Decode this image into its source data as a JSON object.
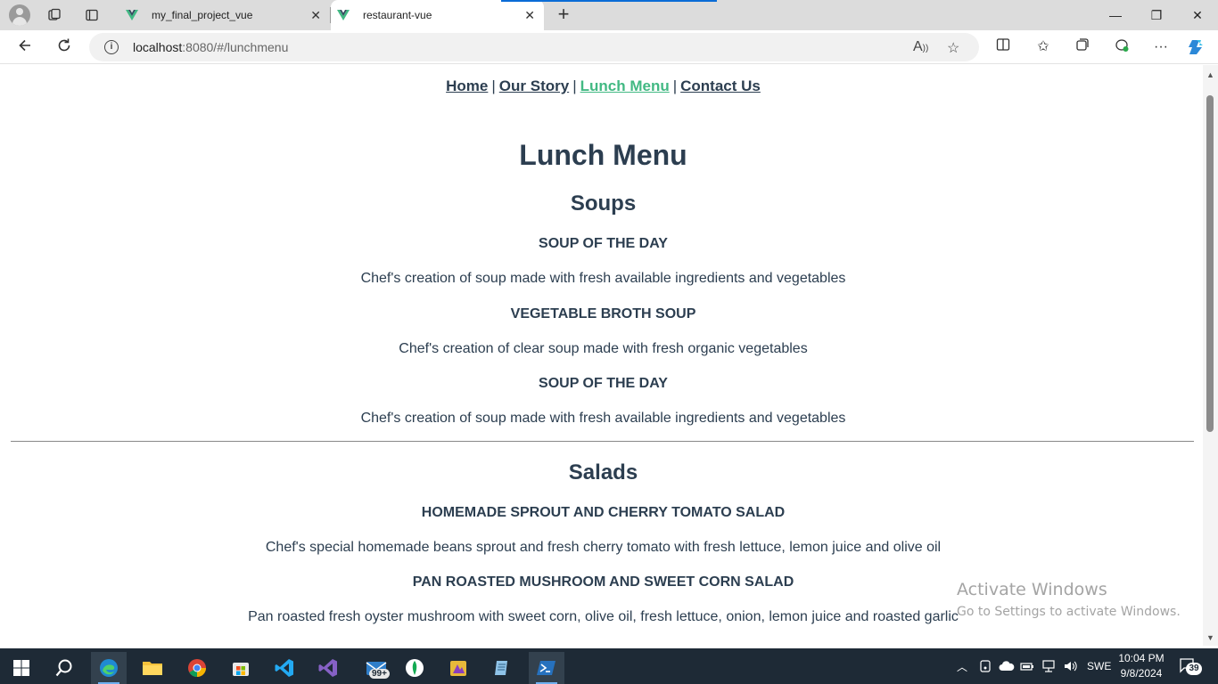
{
  "browser": {
    "tabs": [
      {
        "title": "my_final_project_vue",
        "active": false
      },
      {
        "title": "restaurant-vue",
        "active": true
      }
    ],
    "url_host": "localhost",
    "url_rest": ":8080/#/lunchmenu"
  },
  "nav": {
    "items": [
      "Home",
      "Our Story",
      "Lunch Menu",
      "Contact Us"
    ],
    "separator": "|",
    "active_index": 2
  },
  "page": {
    "title": "Lunch Menu",
    "sections": [
      {
        "title": "Soups",
        "items": [
          {
            "name": "SOUP OF THE DAY",
            "description": "Chef's creation of soup made with fresh available ingredients and vegetables"
          },
          {
            "name": "VEGETABLE BROTH SOUP",
            "description": "Chef's creation of clear soup made with fresh organic vegetables"
          },
          {
            "name": "SOUP OF THE DAY",
            "description": "Chef's creation of soup made with fresh available ingredients and vegetables"
          }
        ]
      },
      {
        "title": "Salads",
        "items": [
          {
            "name": "HOMEMADE SPROUT AND CHERRY TOMATO SALAD",
            "description": "Chef's special homemade beans sprout and fresh cherry tomato with fresh lettuce, lemon juice and olive oil"
          },
          {
            "name": "PAN ROASTED MUSHROOM AND SWEET CORN SALAD",
            "description": "Pan roasted fresh oyster mushroom with sweet corn, olive oil, fresh lettuce, onion, lemon juice and roasted garlic"
          }
        ]
      }
    ]
  },
  "watermark": {
    "line1": "Activate Windows",
    "line2": "Go to Settings to activate Windows."
  },
  "taskbar": {
    "mail_badge": "99+",
    "language": "SWE",
    "time": "10:04 PM",
    "date": "9/8/2024",
    "notifications": "39"
  },
  "colors": {
    "text": "#2c3e50",
    "active_link": "#42b983",
    "taskbar": "#1e2a36"
  }
}
